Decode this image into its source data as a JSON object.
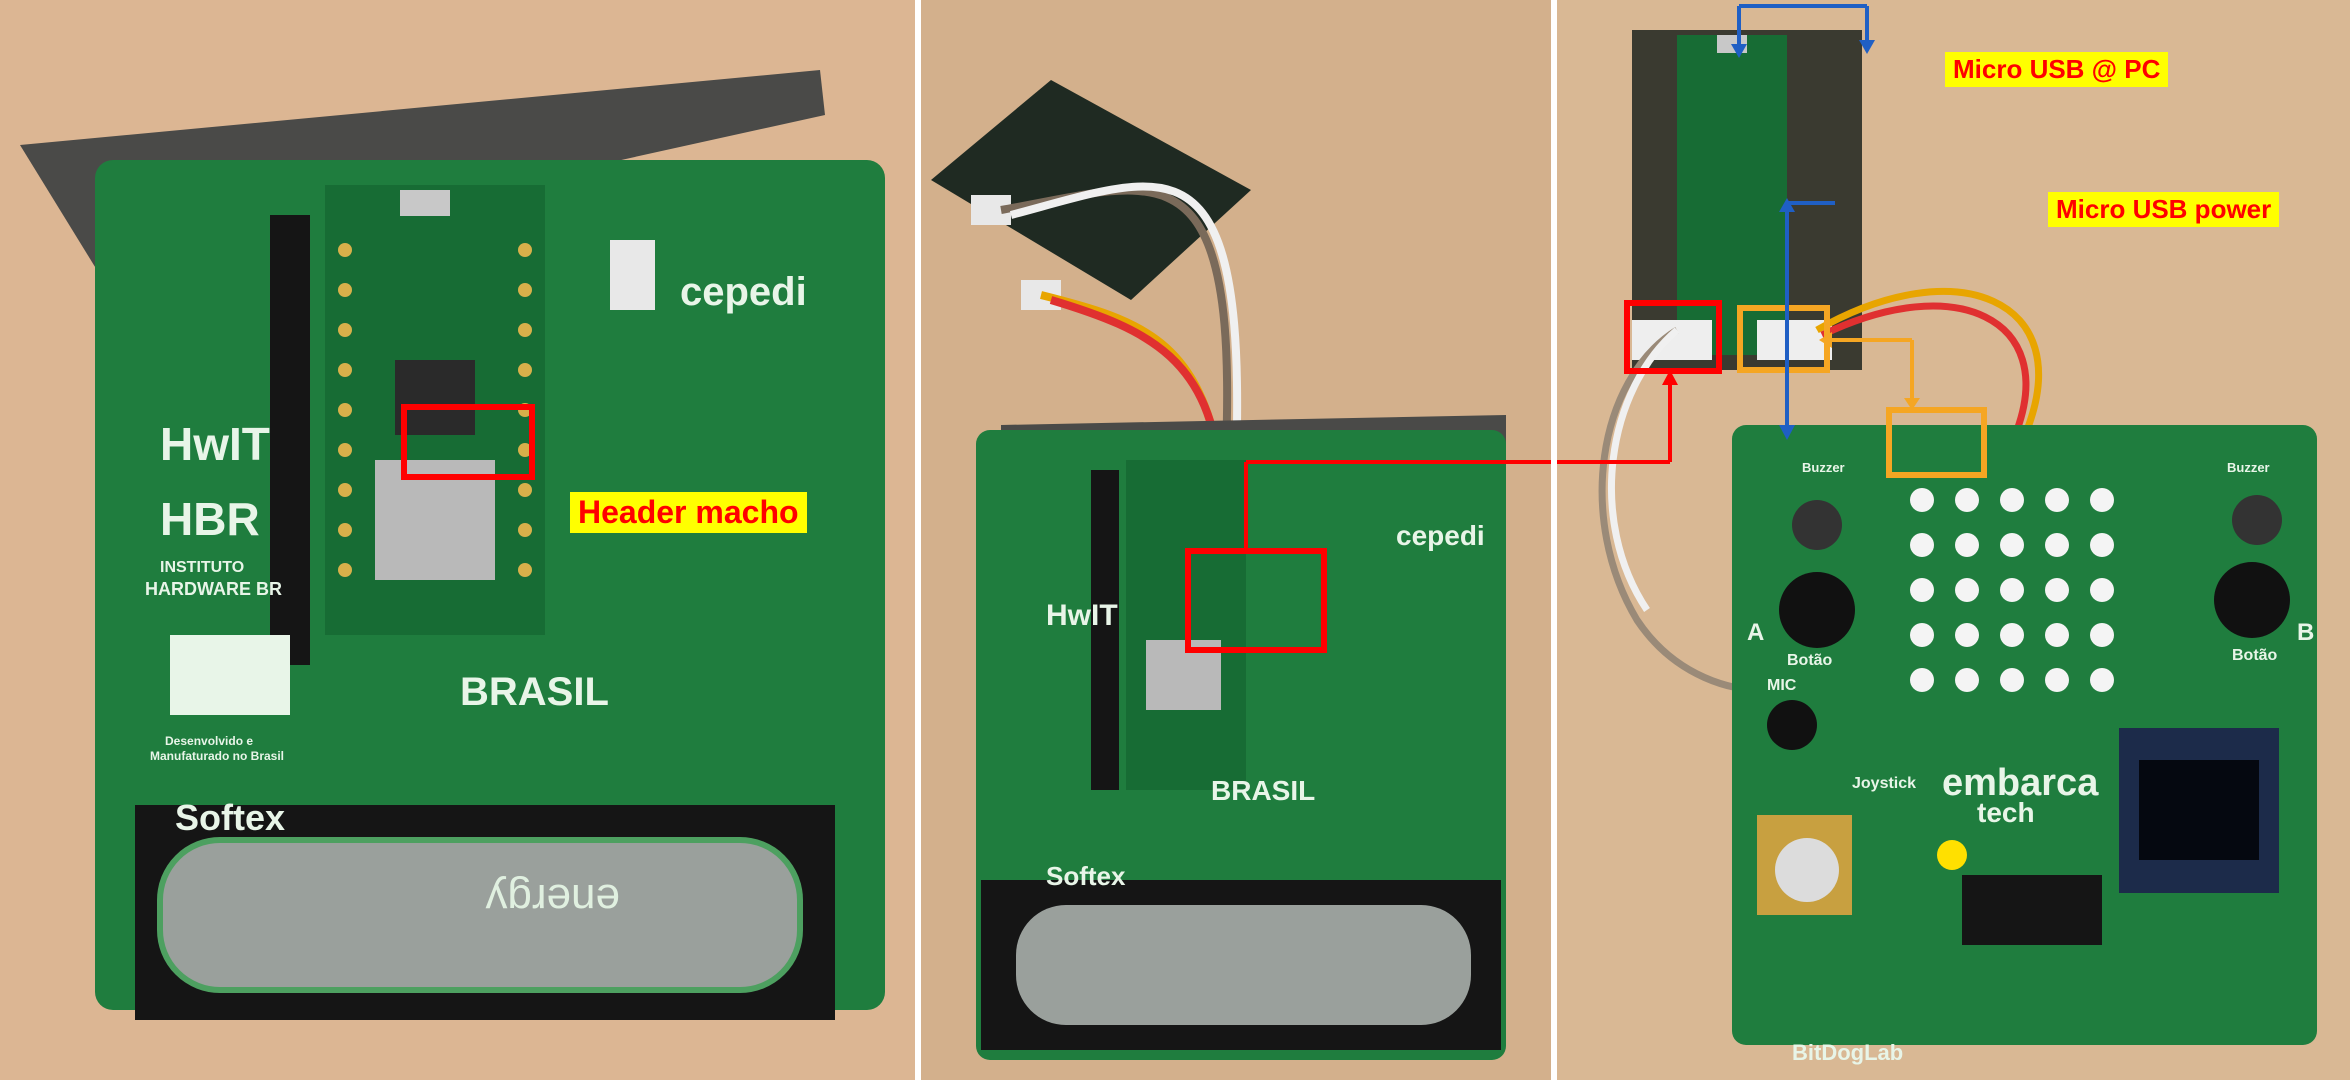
{
  "panels": [
    {
      "annotation": "Header macho",
      "silkscreen": {
        "hwit": "HwIT",
        "hbr": "HBR",
        "instituto": "INSTITUTO",
        "hardware_br": "HARDWARE BR",
        "brazil_text_1": "Desenvolvido e",
        "brazil_text_2": "Manufaturado no Brasil",
        "softex": "Softex",
        "cepedi": "cepedi",
        "brasil": "BRASIL",
        "energy": "energy"
      }
    },
    {
      "silkscreen": {
        "hwit": "HwIT",
        "softex": "Softex",
        "cepedi": "cepedi",
        "brasil": "BRASIL"
      }
    },
    {
      "annotations": [
        "Micro USB @ PC",
        "Micro USB power"
      ],
      "silkscreen": {
        "embarca": "embarca",
        "tech": "tech",
        "joystick": "Joystick",
        "botao_a": "Botão",
        "botao_b": "Botão",
        "mic": "MIC",
        "bitdoglab": "BitDogLab",
        "buzzer": "Buzzer",
        "a": "A",
        "b": "B"
      }
    }
  ],
  "colors": {
    "annotation_text": "#ff0000",
    "annotation_bg": "#ffff00",
    "callout_red": "#ff0000",
    "callout_orange": "#f5a623",
    "arrow_blue": "#1f5fc4",
    "pcb_green": "#1e7a3c",
    "background_wood": "#d9b48e"
  }
}
